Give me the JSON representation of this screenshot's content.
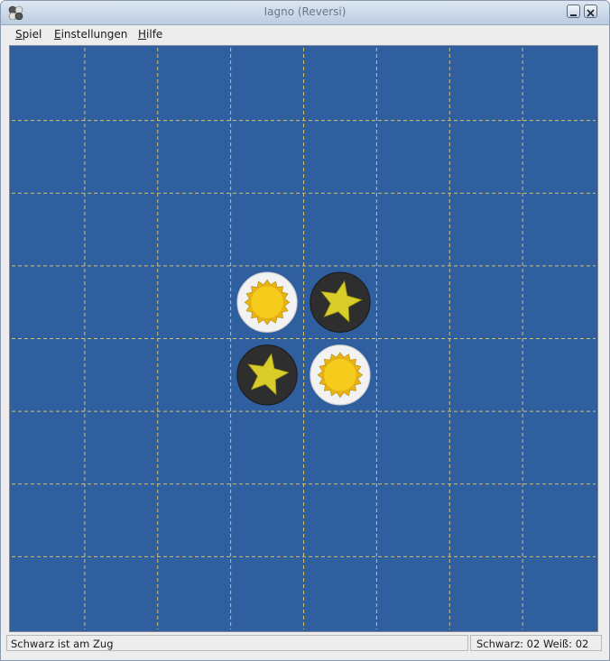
{
  "window": {
    "title": "Iagno (Reversi)"
  },
  "menu": [
    {
      "label": "Spiel",
      "mnemonic": "S",
      "rest": "piel"
    },
    {
      "label": "Einstellungen",
      "mnemonic": "E",
      "rest": "instellungen"
    },
    {
      "label": "Hilfe",
      "mnemonic": "H",
      "rest": "ilfe"
    }
  ],
  "board": {
    "size": 8,
    "colors": {
      "background": "#2f5f9f",
      "grid": "#d8c06a",
      "white_disc": "#f2f2f2",
      "black_disc": "#2e2e2e",
      "sun": "#f6cc1c",
      "star": "#d8cd2a"
    },
    "pieces": [
      {
        "row": 4,
        "col": 4,
        "player": "white",
        "icon": "sun-icon"
      },
      {
        "row": 4,
        "col": 5,
        "player": "black",
        "icon": "star-icon"
      },
      {
        "row": 5,
        "col": 4,
        "player": "black",
        "icon": "star-icon"
      },
      {
        "row": 5,
        "col": 5,
        "player": "white",
        "icon": "sun-icon"
      }
    ]
  },
  "status": {
    "message": "Schwarz ist am Zug",
    "score_black_label": "Schwarz:",
    "score_black": "02",
    "score_white_label": "Weiß:",
    "score_white": "02"
  }
}
